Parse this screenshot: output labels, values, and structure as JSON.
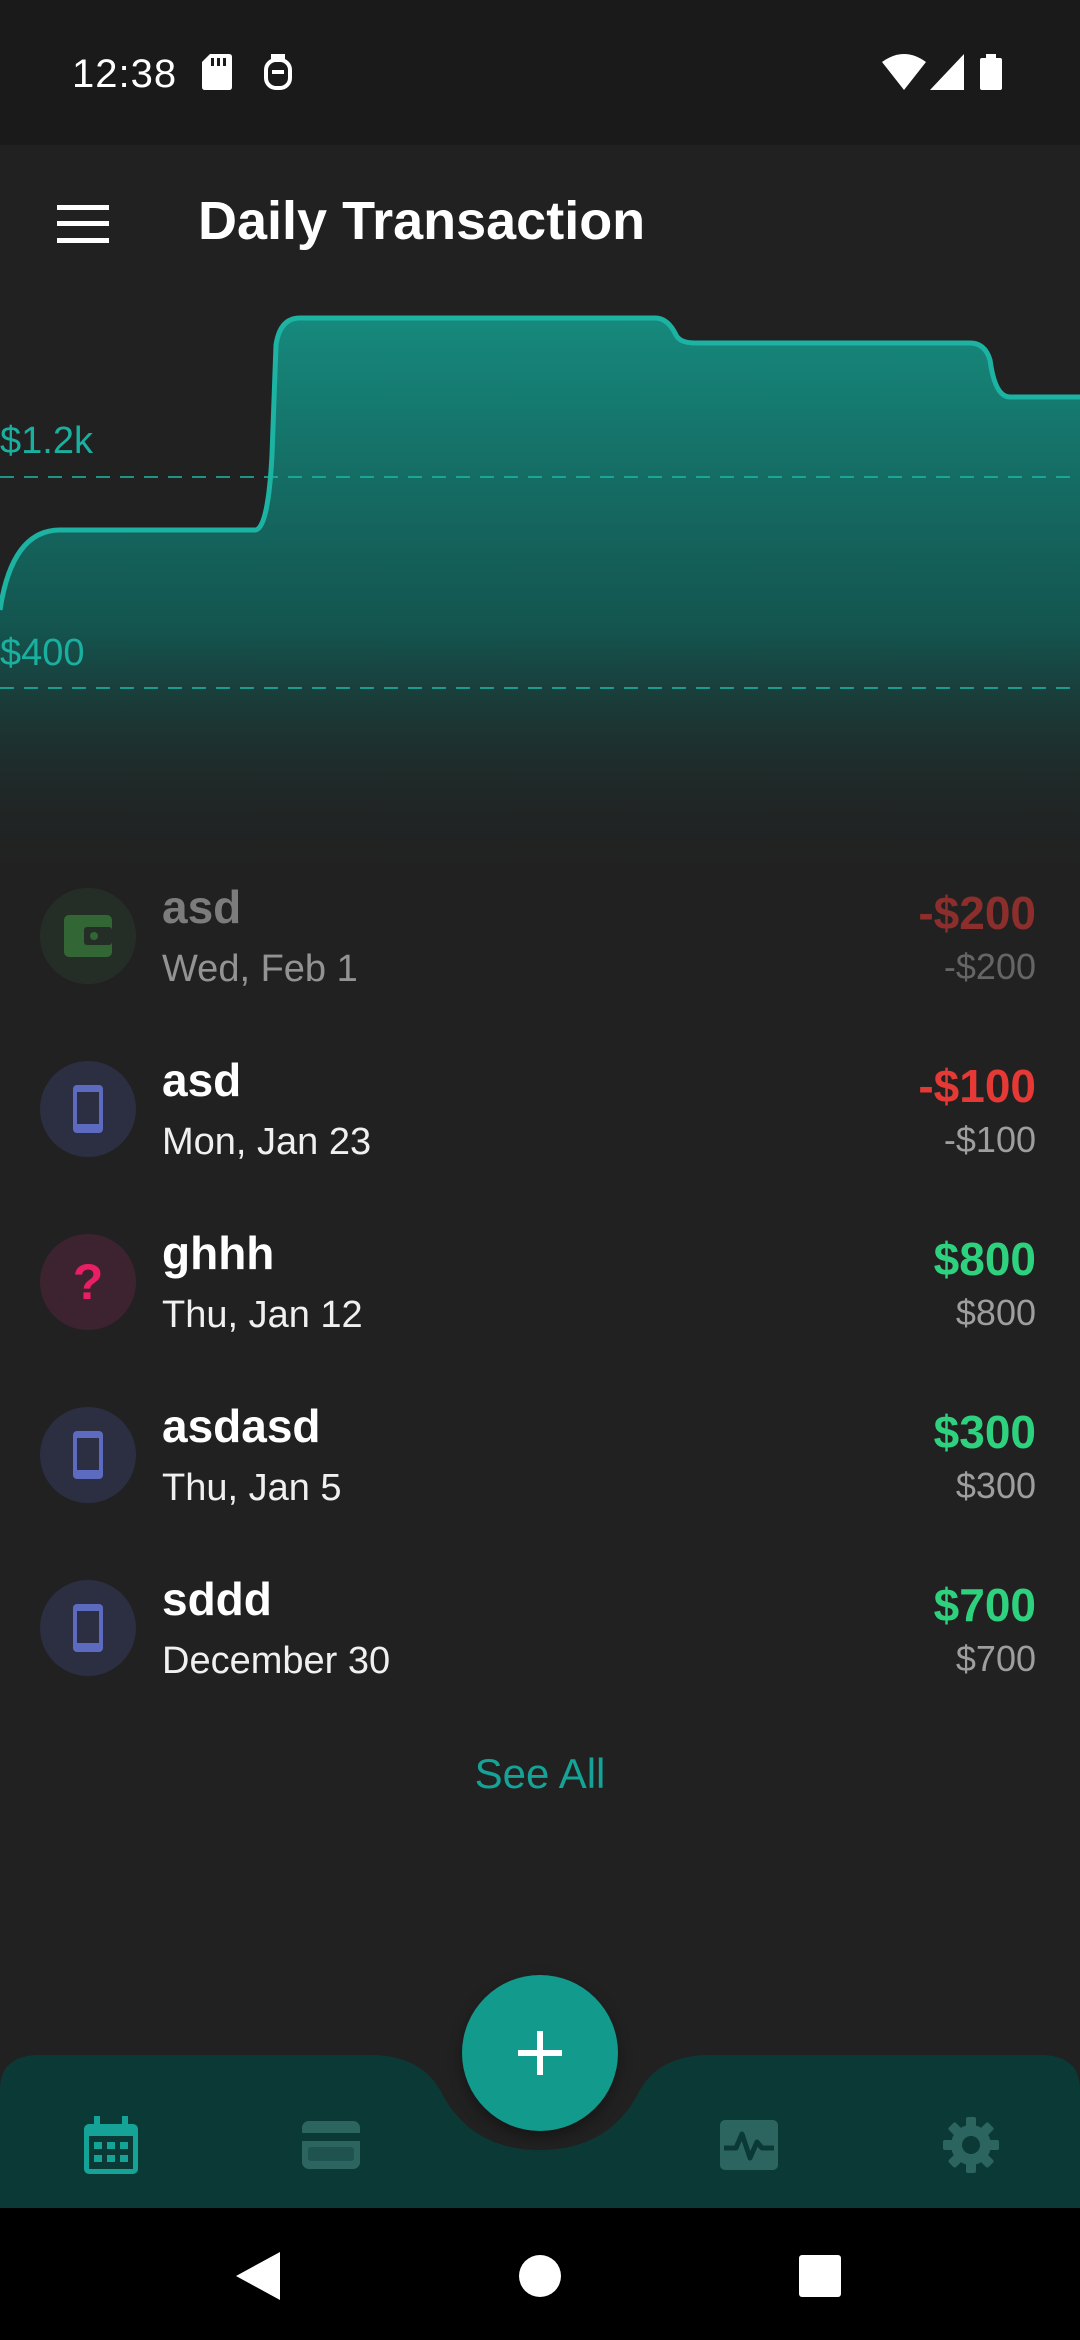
{
  "status_bar": {
    "time": "12:38"
  },
  "app_bar": {
    "title": "Daily Transaction"
  },
  "chart": {
    "label_high": "$1.2k",
    "label_low": "$400"
  },
  "transactions": [
    {
      "name": "asd",
      "date": "Wed, Feb 1",
      "amount": "-$200",
      "sub_amount": "-$200",
      "icon": "wallet-icon",
      "icon_color": "#43a047",
      "amount_color": "#e53935"
    },
    {
      "name": "asd",
      "date": "Mon, Jan 23",
      "amount": "-$100",
      "sub_amount": "-$100",
      "icon": "phone-icon",
      "icon_color": "#5c6bc0",
      "amount_color": "#e53935"
    },
    {
      "name": "ghhh",
      "date": "Thu, Jan 12",
      "amount": "$800",
      "sub_amount": "$800",
      "icon": "question-icon",
      "icon_color": "#e91e63",
      "amount_color": "#2ed27e"
    },
    {
      "name": "asdasd",
      "date": "Thu, Jan 5",
      "amount": "$300",
      "sub_amount": "$300",
      "icon": "phone-icon",
      "icon_color": "#5c6bc0",
      "amount_color": "#2ed27e"
    },
    {
      "name": "sddd",
      "date": "December 30",
      "amount": "$700",
      "sub_amount": "$700",
      "icon": "phone-icon",
      "icon_color": "#5c6bc0",
      "amount_color": "#2ed27e"
    }
  ],
  "see_all_label": "See All",
  "bottom_nav": {
    "items": [
      "calendar-icon",
      "wallet-card-icon",
      "activity-icon",
      "settings-icon"
    ],
    "fab": "add-icon"
  },
  "colors": {
    "accent": "#14a396",
    "background": "#212121",
    "nav_background": "#0b3a36"
  }
}
